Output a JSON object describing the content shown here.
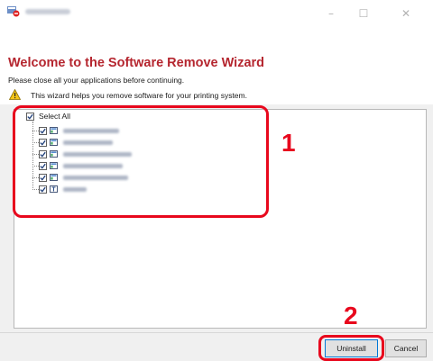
{
  "window": {
    "title": "",
    "controls": [
      "–",
      "☐",
      "✕"
    ]
  },
  "header": {
    "title": "Welcome to the Software Remove Wizard",
    "subtitle": "Please close all your applications before continuing.",
    "description": "This wizard helps you remove software for your printing system."
  },
  "tree": {
    "select_all_label": "Select All",
    "items": [
      {
        "checked": true,
        "label_blurred": true
      },
      {
        "checked": true,
        "label_blurred": true
      },
      {
        "checked": true,
        "label_blurred": true
      },
      {
        "checked": true,
        "label_blurred": true
      },
      {
        "checked": true,
        "label_blurred": true
      },
      {
        "checked": true,
        "label_blurred": true
      }
    ]
  },
  "annotations": {
    "callout_1": "1",
    "callout_2": "2"
  },
  "buttons": {
    "uninstall": "Uninstall",
    "cancel": "Cancel"
  },
  "colors": {
    "title": "#b5262f",
    "callout": "#e8081d",
    "default_button_border": "#0078d7"
  }
}
